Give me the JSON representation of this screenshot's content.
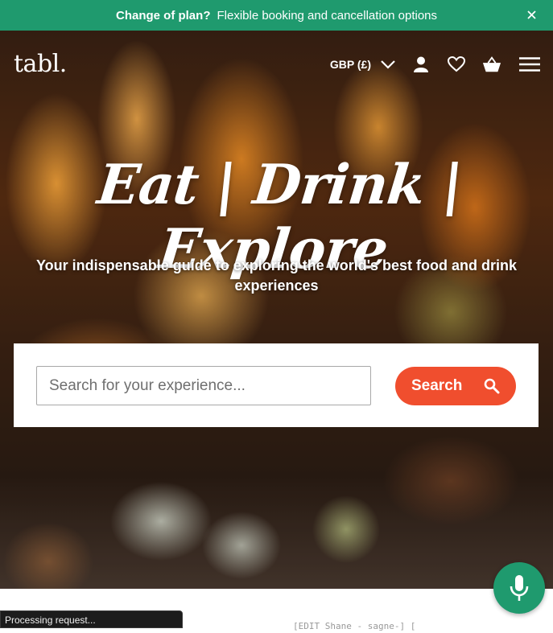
{
  "banner": {
    "title": "Change of plan?",
    "message": "Flexible booking and cancellation options",
    "color": "#1f9a6e"
  },
  "header": {
    "logo": "tabl.",
    "currency": "GBP (£)",
    "icons": [
      "chevron-down-icon",
      "user-icon",
      "heart-icon",
      "basket-icon",
      "menu-icon"
    ]
  },
  "hero": {
    "headline": "Eat | Drink | Explore",
    "subline": "Your indispensable guide to exploring the world's best food and drink experiences"
  },
  "search": {
    "placeholder": "Search for your experience...",
    "button_label": "Search",
    "accent": "#f04e2e"
  },
  "status": {
    "text": "Processing request..."
  },
  "peek": {
    "text": "[EDIT Shane - sagne-] ["
  }
}
